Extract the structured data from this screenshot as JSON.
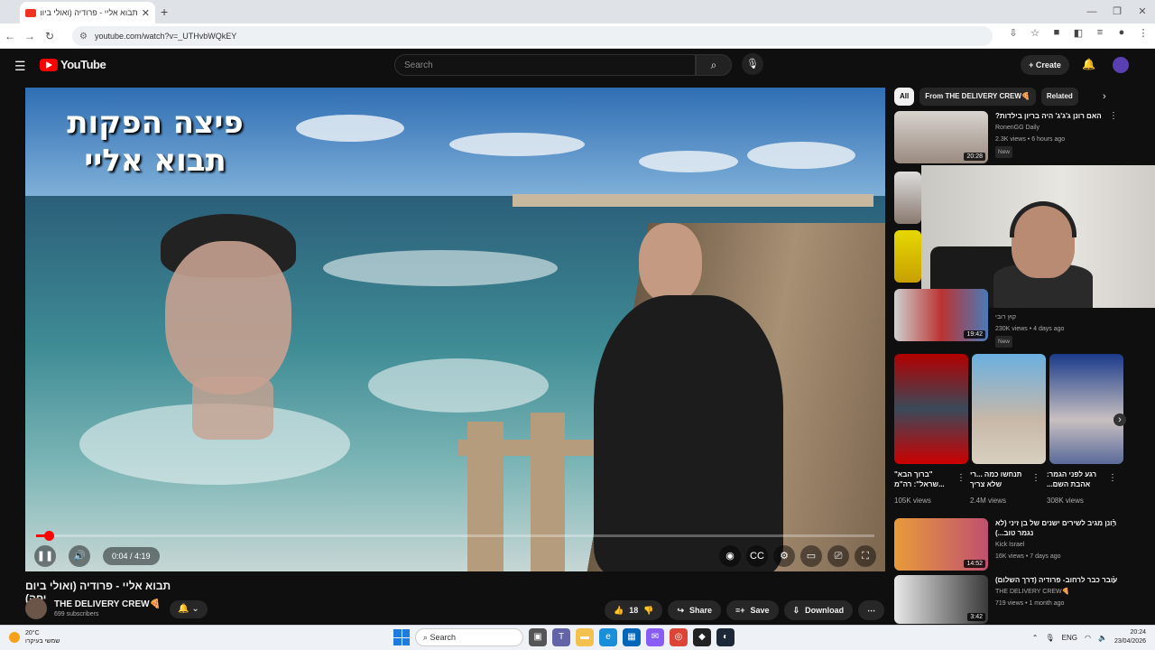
{
  "browser": {
    "tab_title": "תבוא אליי - פרודיה (ואולי ביום יפה)",
    "url": "youtube.com/watch?v=_UTHvbWQkEY"
  },
  "yt": {
    "logo": "YouTube",
    "search_placeholder": "Search",
    "create_label": "Create"
  },
  "video": {
    "overlay_title_line1": "פיצה הפקות",
    "overlay_title_line2": "תבוא אליי",
    "time": "0:04 / 4:19",
    "progress": 0.015,
    "title": "תבוא אליי - פרודיה (ואולי ביום יפה)",
    "channel": "THE DELIVERY CREW🍕",
    "subscribers": "699 subscribers",
    "likes": "18",
    "share_label": "Share",
    "save_label": "Save",
    "download_label": "Download"
  },
  "chips": [
    "All",
    "From THE DELIVERY CREW🍕",
    "Related"
  ],
  "sidebar": {
    "items": [
      {
        "title": "האם רונן ג'ג'ג' היה בריון בילדות?",
        "channel": "RonenGG Daily",
        "meta": "2.3K views • 6 hours ago",
        "badge": "New",
        "duration": "20:28"
      },
      {
        "title": "",
        "channel": "קוץ רובי",
        "meta": "230K views • 4 days ago",
        "badge": "New",
        "duration": "19:42"
      },
      {
        "title": "רונן מגיב לשירים ישנים של בן זיני (לא נגמר טוב...)",
        "channel": "Kick Israel",
        "meta": "16K views • 7 days ago",
        "badge": "",
        "duration": "14:52"
      },
      {
        "title": "עובר כבר לרחוב- פרודיה (דרך השלום)",
        "channel": "THE DELIVERY CREW🍕",
        "meta": "719 views • 1 month ago",
        "badge": "",
        "duration": "3:42"
      }
    ],
    "shorts": [
      {
        "caption": "\"ברוך הבא\" ...שראל\": רה\"מ",
        "views": "105K views"
      },
      {
        "caption": "תנחשו כמה ...רי שלא צריך",
        "views": "2.4M views"
      },
      {
        "caption": "רגע לפני הגמר: אהבת השם...",
        "views": "308K views"
      }
    ]
  },
  "taskbar": {
    "temp": "20°C",
    "weather_desc": "שמשי בעיקרו",
    "search_label": "Search",
    "lang": "ENG",
    "time": "20:24",
    "date": "23/04/2026"
  }
}
